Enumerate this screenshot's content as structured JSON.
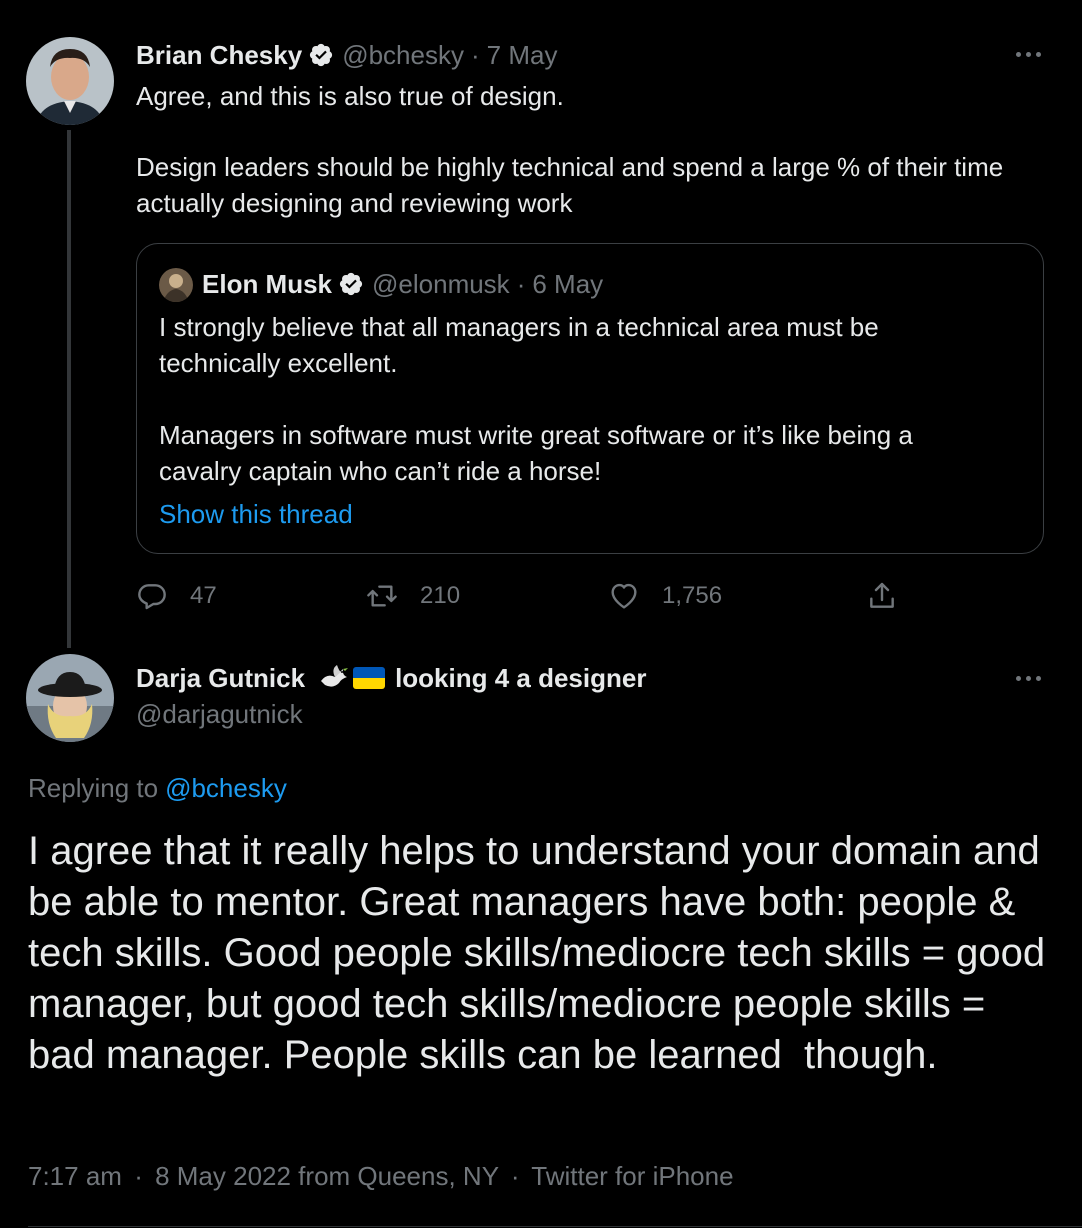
{
  "tweet1": {
    "author_name": "Brian Chesky",
    "handle": "@bchesky",
    "separator": "·",
    "date": "7 May",
    "text_line1": "Agree, and this is also true of design.",
    "text_para2": "Design leaders should be highly technical and spend a large % of their time actually designing and reviewing work",
    "quote": {
      "author_name": "Elon Musk",
      "handle": "@elonmusk",
      "separator": "·",
      "date": "6 May",
      "text_para1": "I strongly believe that all managers in a technical area must be technically excellent.",
      "text_para2": "Managers in software must write great software or it’s like being a cavalry captain who can’t ride a horse!",
      "show_thread_label": "Show this thread"
    },
    "actions": {
      "replies": "47",
      "retweets": "210",
      "likes": "1,756"
    }
  },
  "tweet2": {
    "author_name": "Darja Gutnick",
    "author_suffix": "looking 4 a designer",
    "handle": "@darjagutnick",
    "replying_to_prefix": "Replying to",
    "replying_to_handle": "@bchesky",
    "text": "I agree that it really helps to understand your domain and be able to mentor. Great managers have both: people & tech skills. Good people skills/mediocre tech skills = good manager, but good tech skills/mediocre people skills = bad manager. People skills can be learned  though.",
    "time": "7:17 am",
    "separator": "·",
    "date": "8 May 2022 from Queens, NY",
    "separator2": "·",
    "client": "Twitter for iPhone"
  },
  "colors": {
    "background": "#000000",
    "text_primary": "#e7e9ea",
    "text_muted": "#71767b",
    "link": "#1d9bf0",
    "border": "#3b3f43"
  }
}
